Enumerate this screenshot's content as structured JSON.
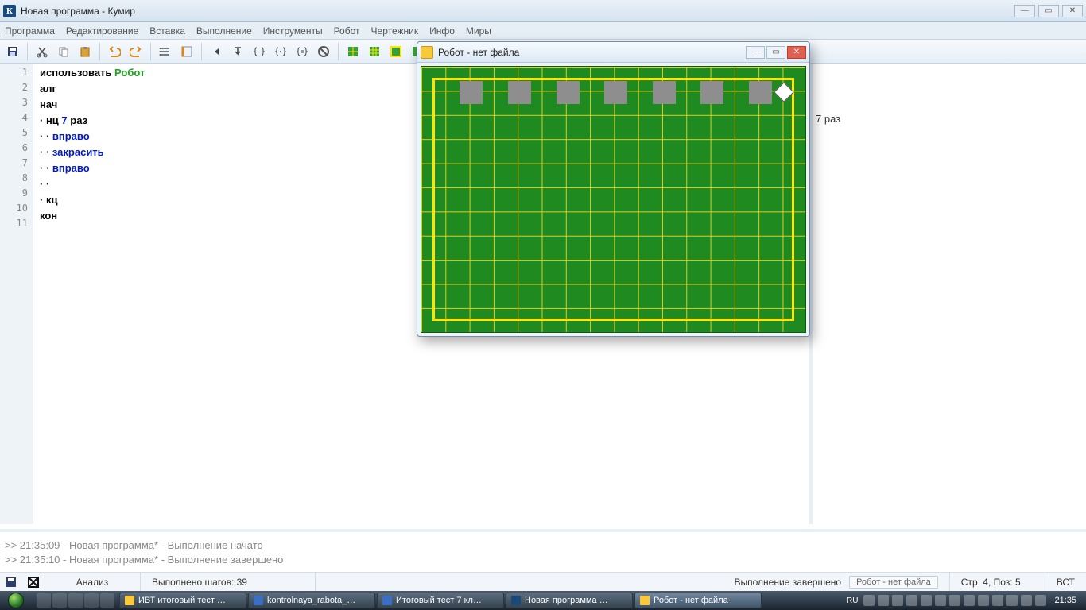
{
  "window": {
    "title": "Новая программа - Кумир",
    "icon_letter": "К"
  },
  "menu": [
    "Программа",
    "Редактирование",
    "Вставка",
    "Выполнение",
    "Инструменты",
    "Робот",
    "Чертежник",
    "Инфо",
    "Миры"
  ],
  "code": {
    "line1_use": "использовать",
    "line1_robot": " Робот",
    "line2": "алг",
    "line3": "нач",
    "line4_pre": "· нц ",
    "line4_num": "7",
    "line4_post": " раз",
    "line5": "· · вправо",
    "line6": "· · закрасить",
    "line7": "· · вправо",
    "line8": "· ·",
    "line9": "· кц",
    "line10": "кон"
  },
  "right_pane": {
    "text": "7  раз"
  },
  "robot_window": {
    "title": "Робот - нет файла",
    "painted_cols": [
      1,
      3,
      5,
      7,
      9,
      11,
      13
    ],
    "robot_col": 14,
    "robot_row": 0
  },
  "console": {
    "line1": ">> 21:35:09 - Новая программа* - Выполнение начато",
    "line2": ">> 21:35:10 - Новая программа* - Выполнение завершено"
  },
  "status": {
    "analysis": "Анализ",
    "steps": "Выполнено шагов: 39",
    "state": "Выполнение завершено",
    "chip": "Робот - нет файла",
    "pos": "Стр: 4, Поз: 5",
    "mode": "ВСТ"
  },
  "taskbar": {
    "lang": "RU",
    "clock": "21:35",
    "tasks": [
      {
        "label": "ИВТ итоговый тест …",
        "icon": "#f9c93b"
      },
      {
        "label": "kontrolnaya_rabota_…",
        "icon": "#3a6fc4"
      },
      {
        "label": "Итоговый тест 7 кл…",
        "icon": "#3a6fc4"
      },
      {
        "label": "Новая программа …",
        "icon": "#194a7a",
        "active": false
      },
      {
        "label": "Робот - нет файла",
        "icon": "#f9c93b",
        "active": true
      }
    ]
  }
}
